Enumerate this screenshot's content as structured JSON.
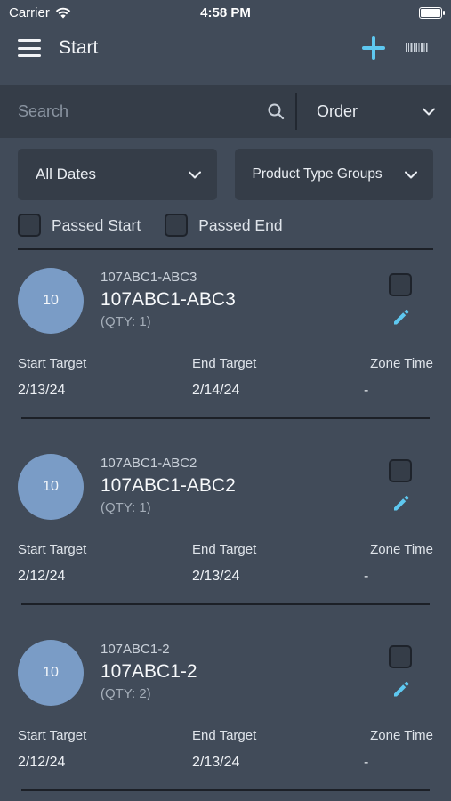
{
  "status_bar": {
    "carrier": "Carrier",
    "time": "4:58 PM"
  },
  "header": {
    "title": "Start",
    "icons": [
      "menu-icon",
      "add-icon",
      "barcode-icon"
    ]
  },
  "search": {
    "placeholder": "Search",
    "value": "",
    "sort_selected": "Order"
  },
  "filters": {
    "date_selected": "All Dates",
    "product_type_selected": "Product Type Groups"
  },
  "checks": {
    "passed_start": "Passed Start",
    "passed_end": "Passed End"
  },
  "columns": {
    "start": "Start Target",
    "end": "End Target",
    "zone": "Zone Time"
  },
  "accent_color": "#5ec8f0",
  "items": [
    {
      "badge": "10",
      "subtitle": "107ABC1-ABC3",
      "title": "107ABC1-ABC3",
      "qty": "(QTY: 1)",
      "start": "2/13/24",
      "end": "2/14/24",
      "zone": "-"
    },
    {
      "badge": "10",
      "subtitle": "107ABC1-ABC2",
      "title": "107ABC1-ABC2",
      "qty": "(QTY: 1)",
      "start": "2/12/24",
      "end": "2/13/24",
      "zone": "-"
    },
    {
      "badge": "10",
      "subtitle": "107ABC1-2",
      "title": "107ABC1-2",
      "qty": "(QTY: 2)",
      "start": "2/12/24",
      "end": "2/13/24",
      "zone": "-"
    }
  ]
}
